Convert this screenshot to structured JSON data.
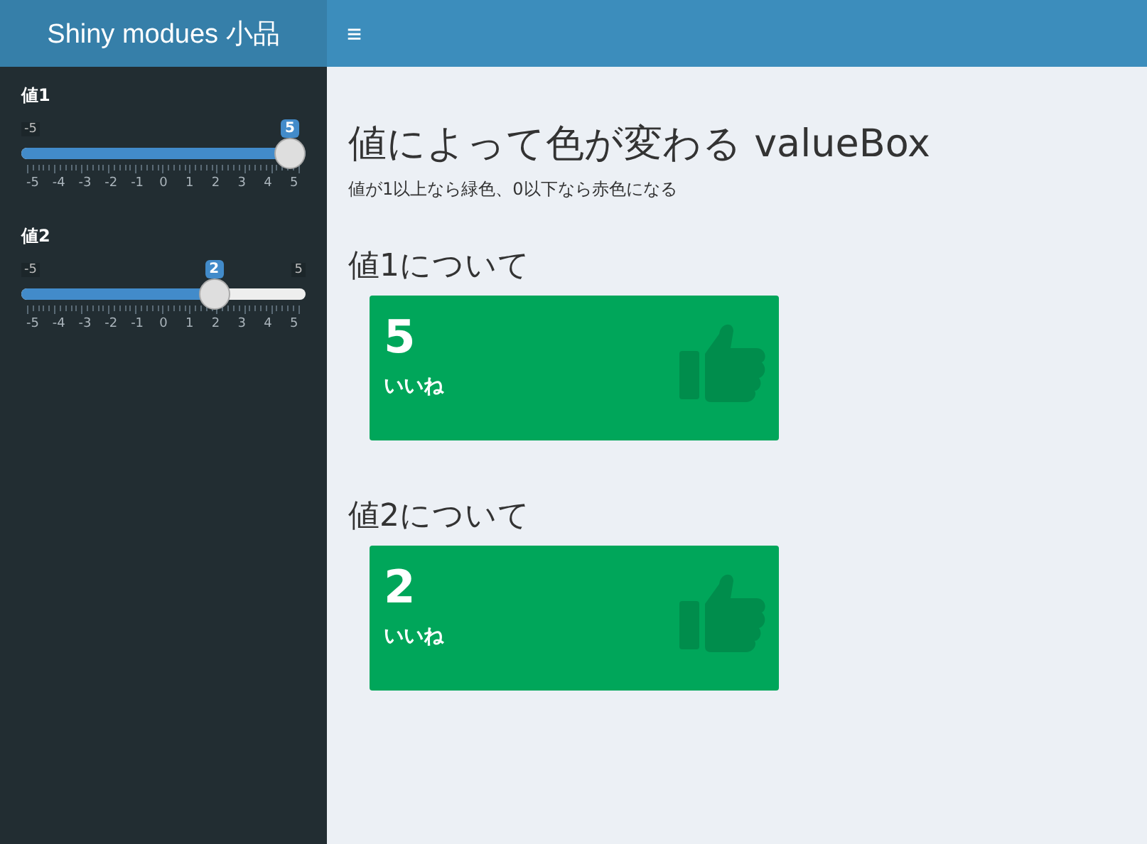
{
  "header": {
    "title": "Shiny modues 小品",
    "menu_icon": "≡"
  },
  "sliders": [
    {
      "label": "値1",
      "min_label": "-5",
      "value": "5",
      "level": 1,
      "ticks": [
        "-5",
        "-4",
        "-3",
        "-2",
        "-1",
        "0",
        "1",
        "2",
        "3",
        "4",
        "5"
      ]
    },
    {
      "label": "値2",
      "min_label": "-5",
      "max_label": "5",
      "value": "2",
      "level": 0.7,
      "ticks": [
        "-5",
        "-4",
        "-3",
        "-2",
        "-1",
        "0",
        "1",
        "2",
        "3",
        "4",
        "5"
      ]
    }
  ],
  "page": {
    "title": "値によって色が変わる valueBox",
    "description": "値が1以上なら緑色、0以下なら赤色になる"
  },
  "sections": [
    {
      "heading": "値1について",
      "box": {
        "value": "5",
        "subtitle": "いいね",
        "color": "#00a65a"
      }
    },
    {
      "heading": "値2について",
      "box": {
        "value": "2",
        "subtitle": "いいね",
        "color": "#00a65a"
      }
    }
  ]
}
